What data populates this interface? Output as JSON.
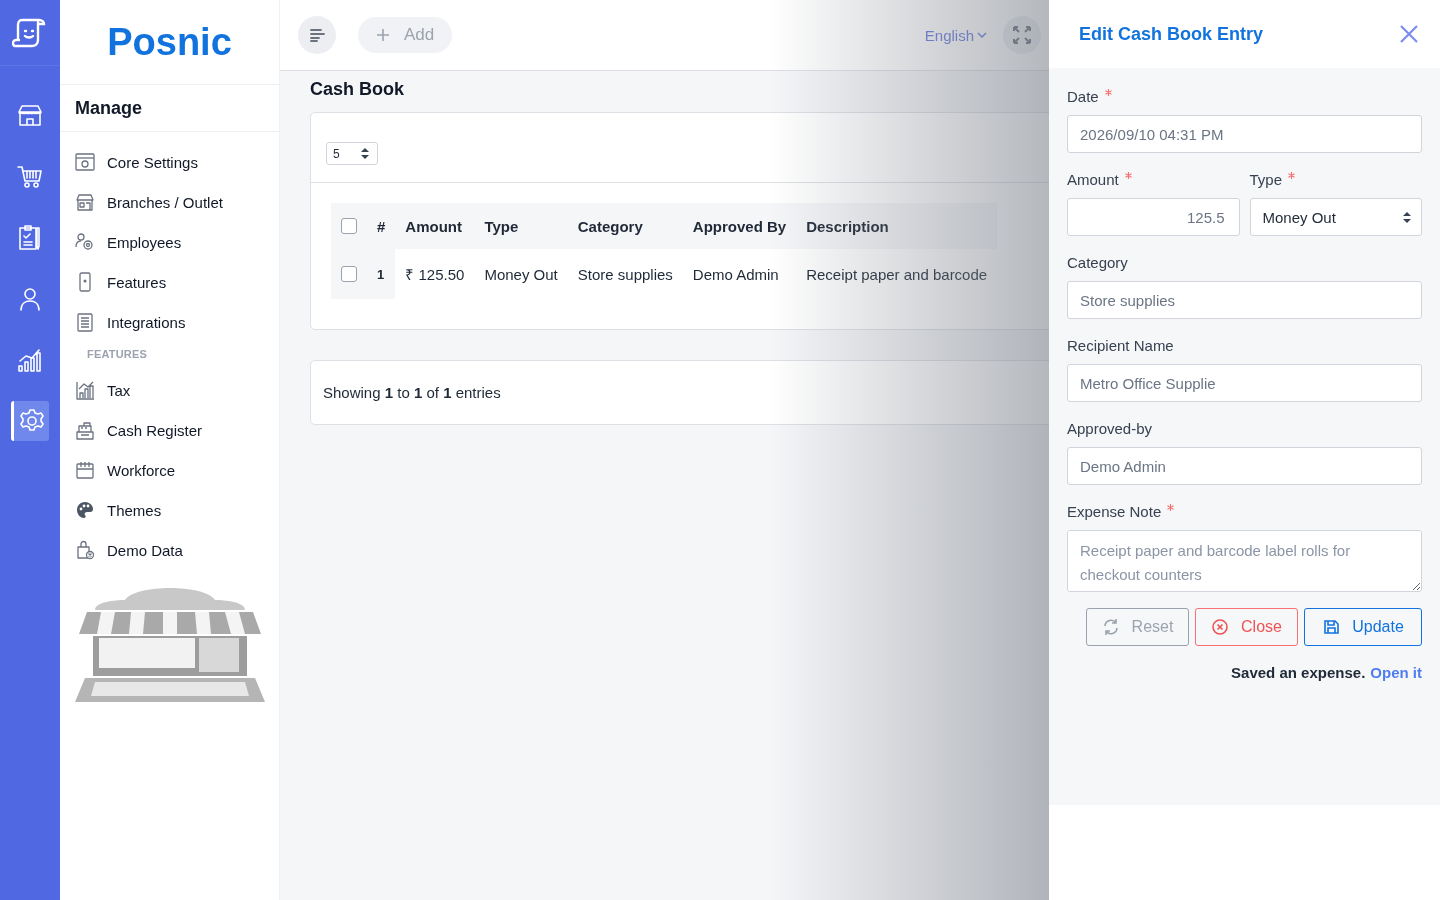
{
  "rail": {
    "items": [
      {
        "kind": "store",
        "selected": false
      },
      {
        "kind": "cart",
        "selected": false
      },
      {
        "kind": "clipboard",
        "selected": false
      },
      {
        "kind": "person",
        "selected": false
      },
      {
        "kind": "chart",
        "selected": false
      },
      {
        "kind": "gear",
        "selected": true
      }
    ]
  },
  "sidebar": {
    "brand": "Posnic",
    "heading": "Manage",
    "sections": [
      {
        "items": [
          {
            "kind": "settings-window",
            "label": "Core Settings"
          },
          {
            "kind": "shop",
            "label": "Branches / Outlet"
          },
          {
            "kind": "users-gear",
            "label": "Employees"
          },
          {
            "kind": "device",
            "label": "Features"
          },
          {
            "kind": "list",
            "label": "Integrations"
          }
        ]
      },
      {
        "title": "FEATURES",
        "items": [
          {
            "kind": "chart",
            "label": "Tax"
          },
          {
            "kind": "register",
            "label": "Cash Register"
          },
          {
            "kind": "calendar",
            "label": "Workforce"
          },
          {
            "kind": "palette",
            "label": "Themes"
          },
          {
            "kind": "bag",
            "label": "Demo Data"
          }
        ]
      }
    ]
  },
  "topbar": {
    "add_button": "Add",
    "language": "English"
  },
  "page_title": "Cash Book",
  "table": {
    "page_size": "5",
    "header_checked": false,
    "columns": [
      "#",
      "Amount",
      "Type",
      "Category",
      "Approved By",
      "Description"
    ],
    "rows": [
      {
        "checked": false,
        "cells": [
          "1",
          "₹ 125.50",
          "Money Out",
          "Store supplies",
          "Demo Admin",
          "Receipt paper and barcode"
        ]
      }
    ]
  },
  "footer": {
    "showing": "Showing **1** to **1** of **1** entries"
  },
  "panel": {
    "title": "Edit Cash Book Entry",
    "rows": [
      [
        {
          "kind": "input",
          "label": "Date",
          "required": true,
          "value": "2026/09/10 04:31 PM"
        }
      ],
      [
        {
          "kind": "number",
          "label": "Amount",
          "required": true,
          "value": "125.5"
        },
        {
          "kind": "select",
          "label": "Type",
          "required": true,
          "value": "Money Out"
        }
      ],
      [
        {
          "kind": "input",
          "label": "Category",
          "required": false,
          "value": "Store supplies"
        }
      ],
      [
        {
          "kind": "input",
          "label": "Recipient Name",
          "required": false,
          "value": "Metro Office Supplie"
        }
      ],
      [
        {
          "kind": "input",
          "label": "Approved-by",
          "required": false,
          "value": "Demo Admin"
        }
      ],
      [
        {
          "kind": "textarea",
          "label": "Expense Note",
          "required": true,
          "value": "Receipt paper and barcode label rolls for checkout counters"
        }
      ]
    ],
    "buttons": [
      {
        "kind": "reset",
        "label": "Reset"
      },
      {
        "kind": "close",
        "label": "Close"
      },
      {
        "kind": "update",
        "label": "Update"
      }
    ],
    "note": {
      "text": "Saved an expense.",
      "link": "Open it"
    }
  }
}
